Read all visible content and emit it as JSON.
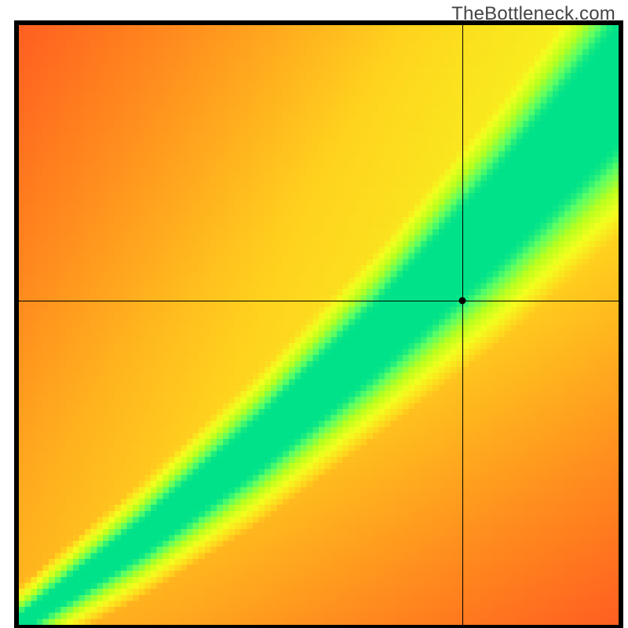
{
  "watermark": "TheBottleneck.com",
  "chart_data": {
    "type": "heatmap",
    "title": "",
    "xlabel": "",
    "ylabel": "",
    "xlim": [
      0,
      100
    ],
    "ylim": [
      0,
      100
    ],
    "grid_resolution": 100,
    "colormap": {
      "0.00": "#ff1e2a",
      "0.25": "#ff7a1e",
      "0.50": "#ffd21e",
      "0.70": "#f3ff1e",
      "0.85": "#b8ff1e",
      "0.95": "#5cff64",
      "1.00": "#00e28a"
    },
    "ridge": {
      "control_points_xy": [
        [
          0,
          0
        ],
        [
          20,
          14
        ],
        [
          40,
          30
        ],
        [
          60,
          48
        ],
        [
          80,
          68
        ],
        [
          100,
          90
        ]
      ],
      "width_at_x": [
        [
          0,
          2
        ],
        [
          30,
          6
        ],
        [
          60,
          10
        ],
        [
          100,
          18
        ]
      ]
    },
    "crosshair": {
      "x": 74,
      "y": 54
    },
    "annotations": []
  }
}
